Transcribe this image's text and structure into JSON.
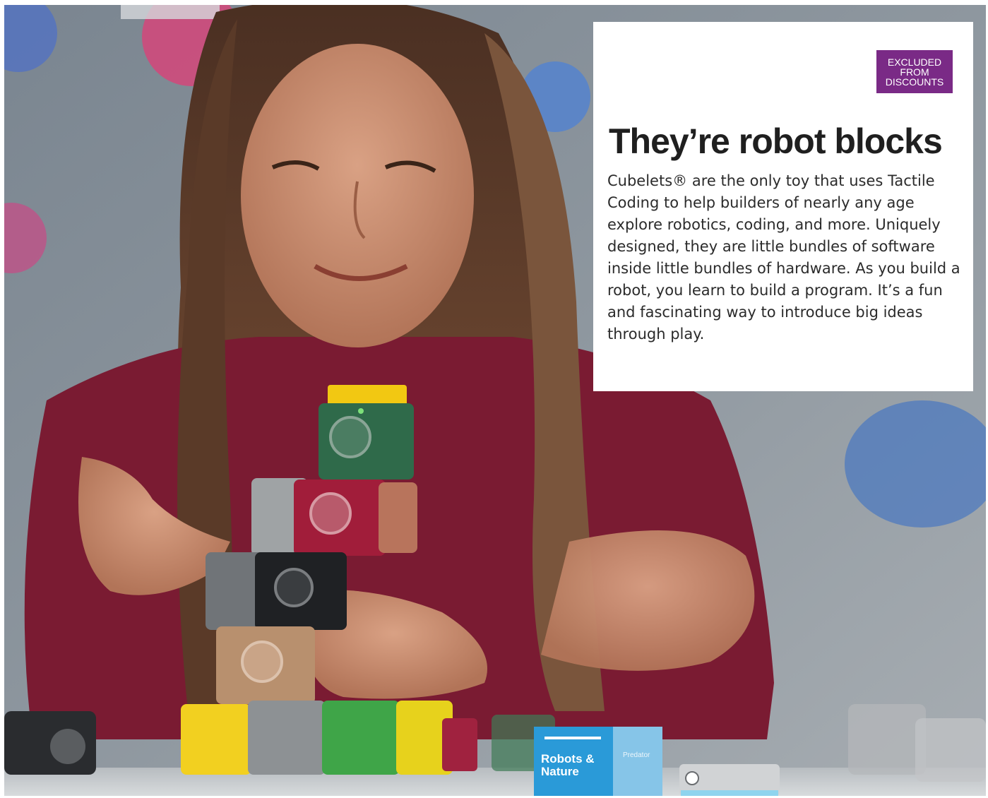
{
  "badge": {
    "line1": "EXCLUDED",
    "line2": "FROM",
    "line3": "DISCOUNTS",
    "color": "#7a2a86"
  },
  "headline": "They’re robot blocks",
  "body": "Cubelets® are the only toy that uses Tactile Coding to help builders of nearly any age explore robotics, coding, and more. Uniquely designed, they are little bundles of software inside little bundles of hardware. As you build a robot, you learn to build a program. It’s a fun and fascinating way to introduce big ideas through play.",
  "product_box": {
    "title_line1": "Robots &",
    "title_line2": "Nature",
    "side_label": "Predator",
    "accent": "#2a9ad8"
  }
}
